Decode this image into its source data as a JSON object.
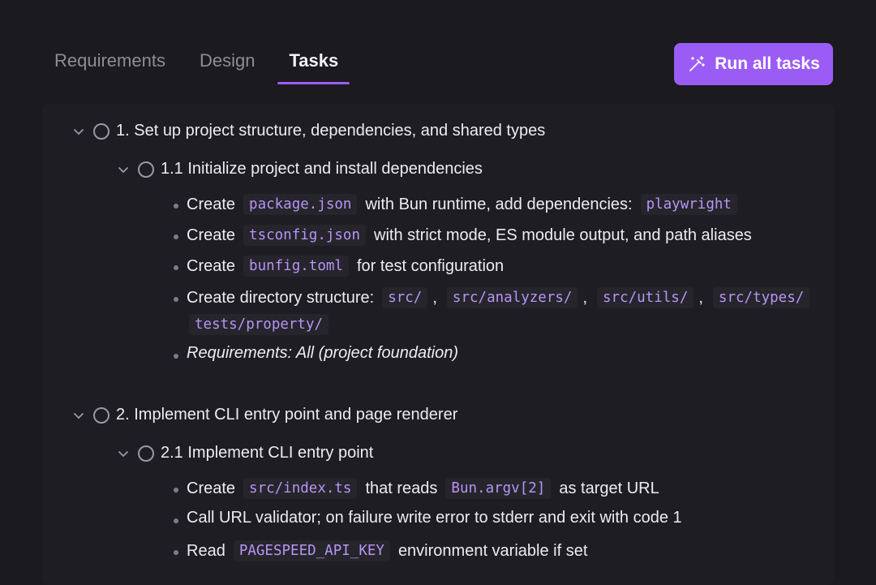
{
  "tabs": [
    {
      "label": "Requirements",
      "active": false
    },
    {
      "label": "Design",
      "active": false
    },
    {
      "label": "Tasks",
      "active": true
    }
  ],
  "run_button": {
    "label": "Run all tasks",
    "icon": "magic-wand-icon"
  },
  "colors": {
    "accent": "#9b5cf6",
    "code_text": "#b794f6",
    "background": "#1b1a1f"
  },
  "tasks": [
    {
      "label": "1. Set up project structure, dependencies, and shared types",
      "subtasks": [
        {
          "label": "1.1 Initialize project and install dependencies",
          "items": [
            {
              "t1": "Create",
              "c1": "package.json",
              "t2": "with Bun runtime, add dependencies:",
              "c2": "playwright"
            },
            {
              "t1": "Create",
              "c1": "tsconfig.json",
              "t2": "with strict mode, ES module output, and path aliases"
            },
            {
              "t1": "Create",
              "c1": "bunfig.toml",
              "t2": "for test configuration"
            },
            {
              "t1": "Create directory structure:",
              "c1": "src/",
              "s1": ",",
              "c2": "src/analyzers/",
              "s2": ",",
              "c3": "src/utils/",
              "s3": ",",
              "c4": "src/types/",
              "c5": "tests/property/"
            },
            {
              "t1": "Requirements: All (project foundation)"
            }
          ]
        }
      ]
    },
    {
      "label": "2. Implement CLI entry point and page renderer",
      "subtasks": [
        {
          "label": "2.1 Implement CLI entry point",
          "items": [
            {
              "t1": "Create",
              "c1": "src/index.ts",
              "t2": "that reads",
              "c2": "Bun.argv[2]",
              "t3": "as target URL"
            },
            {
              "t1": "Call URL validator; on failure write error to stderr and exit with code 1"
            },
            {
              "t1": "Read",
              "c1": "PAGESPEED_API_KEY",
              "t2": "environment variable if set"
            }
          ]
        }
      ]
    }
  ]
}
